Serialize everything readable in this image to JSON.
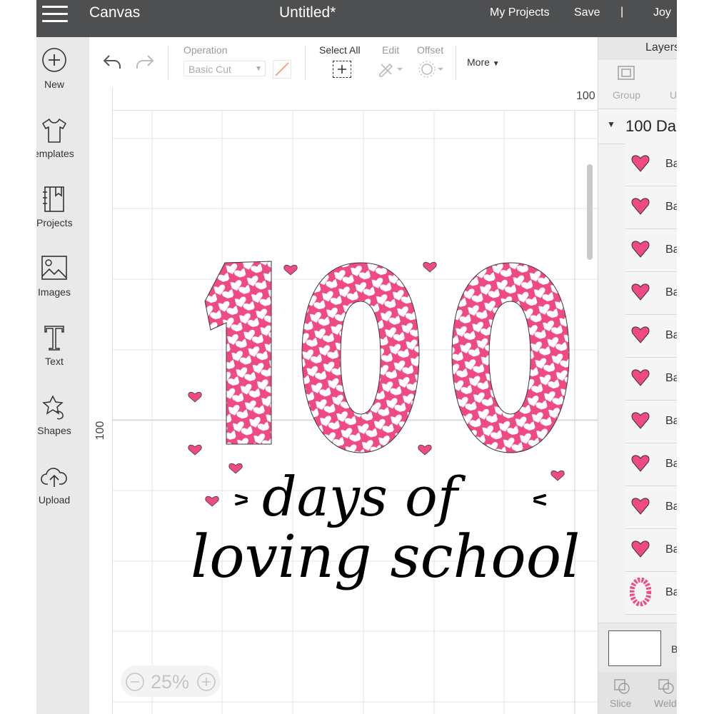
{
  "header": {
    "app_name": "Canvas",
    "document_title": "Untitled*",
    "my_projects": "My Projects",
    "save": "Save",
    "separator": "|",
    "user": "Joy"
  },
  "sidebar": {
    "items": [
      {
        "label": "New",
        "icon": "plus-circle-icon"
      },
      {
        "label": "emplates",
        "icon": "tshirt-icon"
      },
      {
        "label": "Projects",
        "icon": "projects-book-icon"
      },
      {
        "label": "Images",
        "icon": "image-icon"
      },
      {
        "label": "Text",
        "icon": "text-t-icon"
      },
      {
        "label": "Shapes",
        "icon": "shapes-icon"
      },
      {
        "label": "Upload",
        "icon": "cloud-upload-icon"
      }
    ]
  },
  "toolbar": {
    "operation_label": "Operation",
    "operation_value": "Basic Cut",
    "select_all": "Select All",
    "edit": "Edit",
    "offset": "Offset",
    "more": "More"
  },
  "canvas": {
    "ruler_top_value": "100",
    "ruler_left_value": "100",
    "zoom": "25%",
    "design": {
      "big_number": "100",
      "line1": "days of",
      "line2": "loving school",
      "pink": "#f04a86",
      "ink": "#000000"
    }
  },
  "layers_panel": {
    "title": "Layers",
    "group": "Group",
    "ungroup_partial": "U",
    "group_name": "100 Da",
    "rows": [
      {
        "name": "Ba",
        "thumb": "heart"
      },
      {
        "name": "Ba",
        "thumb": "heart"
      },
      {
        "name": "Ba",
        "thumb": "heart"
      },
      {
        "name": "Ba",
        "thumb": "heart"
      },
      {
        "name": "Ba",
        "thumb": "heart"
      },
      {
        "name": "Ba",
        "thumb": "heart"
      },
      {
        "name": "Ba",
        "thumb": "heart"
      },
      {
        "name": "Ba",
        "thumb": "heart"
      },
      {
        "name": "Ba",
        "thumb": "heart"
      },
      {
        "name": "Ba",
        "thumb": "heart"
      },
      {
        "name": "Ba",
        "thumb": "zero"
      }
    ],
    "footer_label": "B",
    "slice": "Slice",
    "weld": "Weld"
  }
}
